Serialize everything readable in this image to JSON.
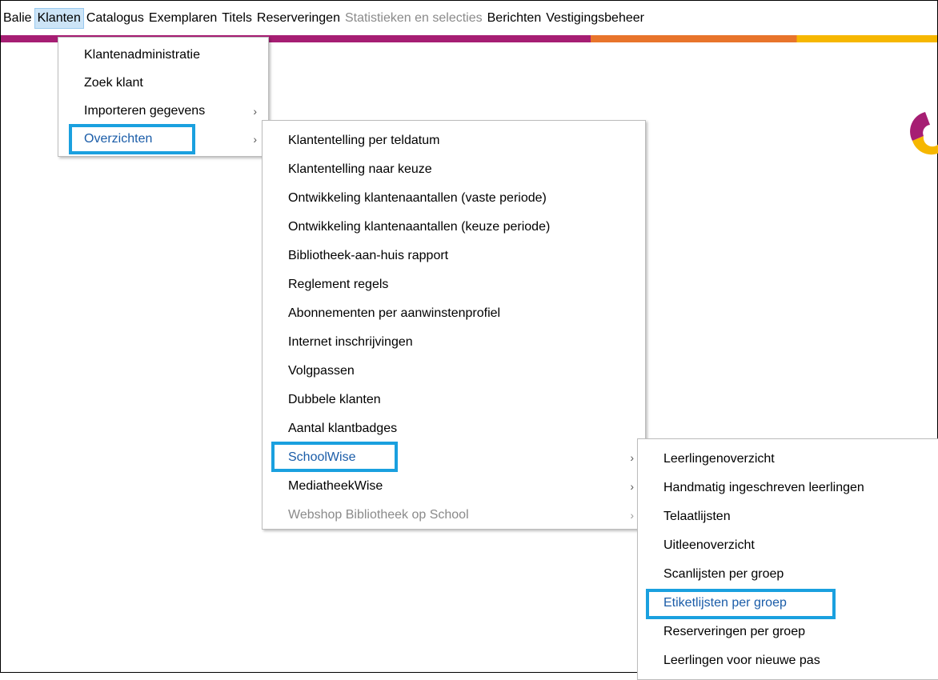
{
  "menubar": {
    "items": [
      {
        "label": "Balie"
      },
      {
        "label": "Klanten",
        "active": true
      },
      {
        "label": "Catalogus"
      },
      {
        "label": "Exemplaren"
      },
      {
        "label": "Titels"
      },
      {
        "label": "Reserveringen"
      },
      {
        "label": "Statistieken en selecties",
        "disabled": true
      },
      {
        "label": "Berichten"
      },
      {
        "label": "Vestigingsbeheer"
      }
    ]
  },
  "klanten_menu": {
    "items": [
      {
        "label": "Klantenadministratie"
      },
      {
        "label": "Zoek klant"
      },
      {
        "label": "Importeren gegevens",
        "submenu": true
      },
      {
        "label": "Overzichten",
        "submenu": true,
        "highlighted": true
      }
    ]
  },
  "overzichten_menu": {
    "items": [
      {
        "label": "Klantentelling per teldatum"
      },
      {
        "label": "Klantentelling naar keuze"
      },
      {
        "label": "Ontwikkeling klantenaantallen (vaste periode)"
      },
      {
        "label": "Ontwikkeling klantenaantallen (keuze periode)"
      },
      {
        "label": "Bibliotheek-aan-huis rapport"
      },
      {
        "label": "Reglement regels"
      },
      {
        "label": "Abonnementen per aanwinstenprofiel"
      },
      {
        "label": "Internet inschrijvingen"
      },
      {
        "label": "Volgpassen"
      },
      {
        "label": "Dubbele klanten"
      },
      {
        "label": "Aantal klantbadges"
      },
      {
        "label": "SchoolWise",
        "submenu": true,
        "highlighted": true
      },
      {
        "label": "MediatheekWise",
        "submenu": true
      },
      {
        "label": "Webshop Bibliotheek op School",
        "submenu": true,
        "disabled": true
      }
    ]
  },
  "schoolwise_menu": {
    "items": [
      {
        "label": "Leerlingenoverzicht"
      },
      {
        "label": "Handmatig ingeschreven leerlingen"
      },
      {
        "label": "Telaatlijsten"
      },
      {
        "label": "Uitleenoverzicht"
      },
      {
        "label": "Scanlijsten per groep"
      },
      {
        "label": "Etiketlijsten per groep",
        "highlighted": true
      },
      {
        "label": "Reserveringen per groep"
      },
      {
        "label": "Leerlingen voor nieuwe pas"
      }
    ]
  },
  "colors": {
    "highlight_border": "#1aa0df",
    "stripe": [
      "#a61e73",
      "#e8742b",
      "#f6b700"
    ]
  }
}
